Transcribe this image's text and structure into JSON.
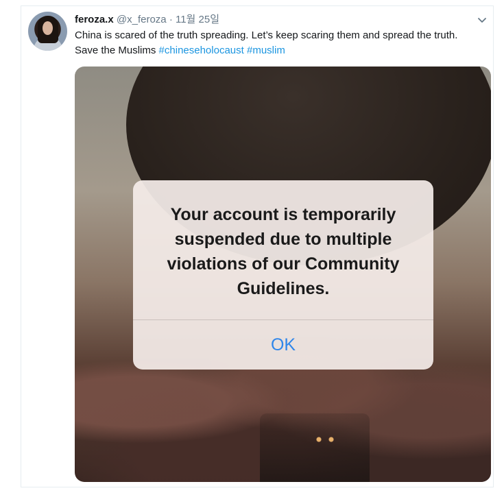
{
  "tweet": {
    "display_name": "feroza.x",
    "handle": "@x_feroza",
    "separator": "·",
    "date": "11월 25일",
    "text_plain": "China is scared of the truth spreading. Let’s keep scaring them and spread the truth. Save the Muslims ",
    "hashtags": [
      "#chineseholocaust",
      "#muslim"
    ]
  },
  "alert": {
    "message": "Your account is temporarily suspended due to multiple violations of our Community Guidelines.",
    "ok_label": "OK"
  },
  "colors": {
    "hashtag": "#1b95e0",
    "ok_button": "#2f86ea",
    "muted_text": "#657786"
  },
  "icons": {
    "menu": "chevron-down-icon"
  }
}
